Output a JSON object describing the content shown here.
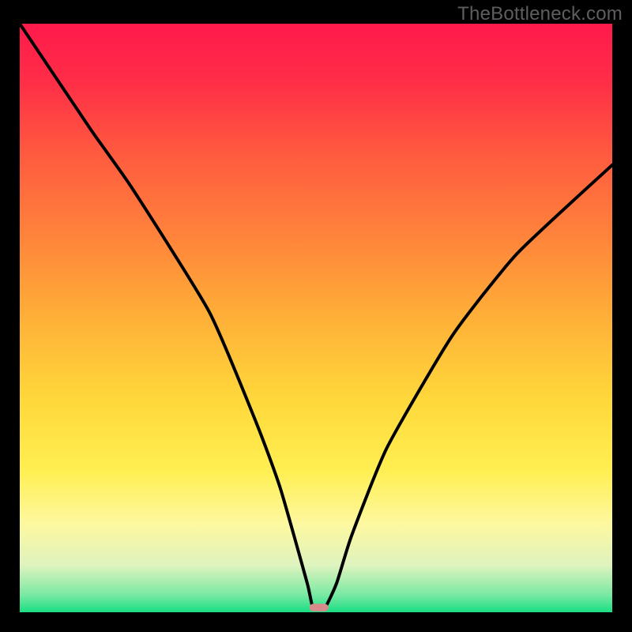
{
  "watermark": "TheBottleneck.com",
  "chart_data": {
    "type": "line",
    "title": "",
    "xlabel": "",
    "ylabel": "",
    "xlim": [
      0,
      100
    ],
    "ylim": [
      0,
      100
    ],
    "grid": false,
    "series": [
      {
        "name": "curve",
        "x": [
          0,
          12,
          19,
          32,
          40,
          44,
          48.5,
          49.5,
          51.5,
          53.5,
          56,
          62,
          73,
          84,
          100
        ],
        "y": [
          100,
          82,
          72,
          51,
          32,
          21,
          5,
          0.8,
          0.8,
          5,
          13,
          28,
          47,
          61,
          76
        ],
        "color": "#000000"
      }
    ],
    "marker": {
      "x": 50.5,
      "y": 0.8,
      "width": 3.2,
      "height": 1.3,
      "color": "#d98a8a"
    },
    "gradient_stops": [
      {
        "offset": 0,
        "color": "#ff1a4c"
      },
      {
        "offset": 0.1,
        "color": "#ff2e47"
      },
      {
        "offset": 0.22,
        "color": "#ff5a3f"
      },
      {
        "offset": 0.36,
        "color": "#ff833b"
      },
      {
        "offset": 0.5,
        "color": "#ffb038"
      },
      {
        "offset": 0.64,
        "color": "#ffd83b"
      },
      {
        "offset": 0.76,
        "color": "#ffef52"
      },
      {
        "offset": 0.85,
        "color": "#fdf8a0"
      },
      {
        "offset": 0.92,
        "color": "#dff3be"
      },
      {
        "offset": 0.97,
        "color": "#7be9a4"
      },
      {
        "offset": 1.0,
        "color": "#19de83"
      }
    ]
  }
}
